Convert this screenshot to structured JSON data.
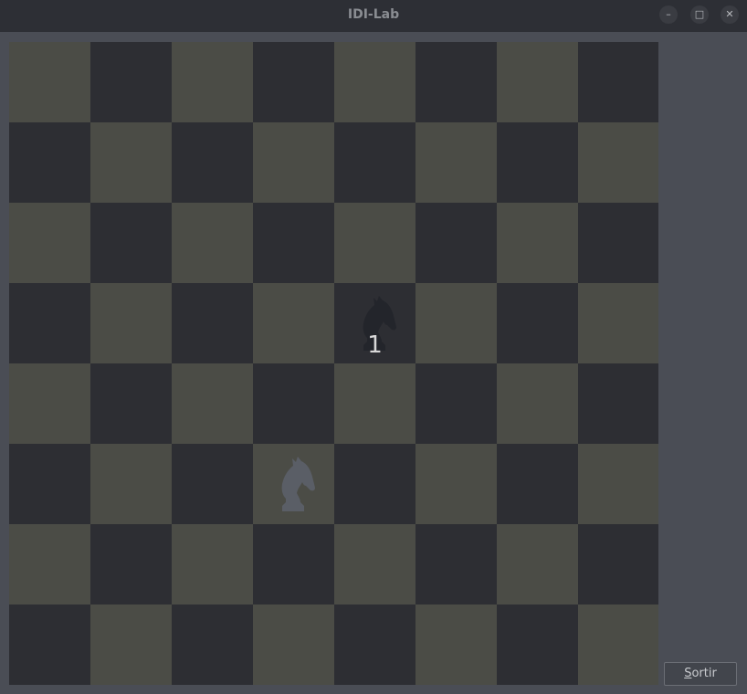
{
  "window": {
    "title": "IDI-Lab",
    "buttons": [
      "minimize",
      "maximize",
      "close"
    ]
  },
  "board": {
    "size": 8,
    "squares": [
      [
        "light",
        "dark",
        "light",
        "dark",
        "light",
        "dark",
        "light",
        "dark"
      ],
      [
        "dark",
        "light",
        "dark",
        "light",
        "dark",
        "light",
        "dark",
        "light"
      ],
      [
        "light",
        "dark",
        "light",
        "dark",
        "light",
        "dark",
        "light",
        "dark"
      ],
      [
        "dark",
        "light",
        "dark",
        "light",
        "dark",
        "light",
        "dark",
        "light"
      ],
      [
        "light",
        "dark",
        "light",
        "dark",
        "light",
        "dark",
        "light",
        "dark"
      ],
      [
        "dark",
        "light",
        "dark",
        "light",
        "dark",
        "light",
        "dark",
        "light"
      ],
      [
        "light",
        "dark",
        "light",
        "dark",
        "light",
        "dark",
        "light",
        "dark"
      ],
      [
        "dark",
        "light",
        "dark",
        "light",
        "dark",
        "light",
        "dark",
        "light"
      ]
    ],
    "colors": {
      "light": "#4b4c46",
      "dark": "#2d2e33"
    },
    "pieces": [
      {
        "type": "knight",
        "color": "#23252b",
        "row": 3,
        "col": 4,
        "label": "1"
      },
      {
        "type": "knight",
        "color": "#5a5e66",
        "row": 5,
        "col": 3,
        "label": ""
      }
    ]
  },
  "footer": {
    "exit_label_mnemonic": "S",
    "exit_label_rest": "ortir"
  }
}
